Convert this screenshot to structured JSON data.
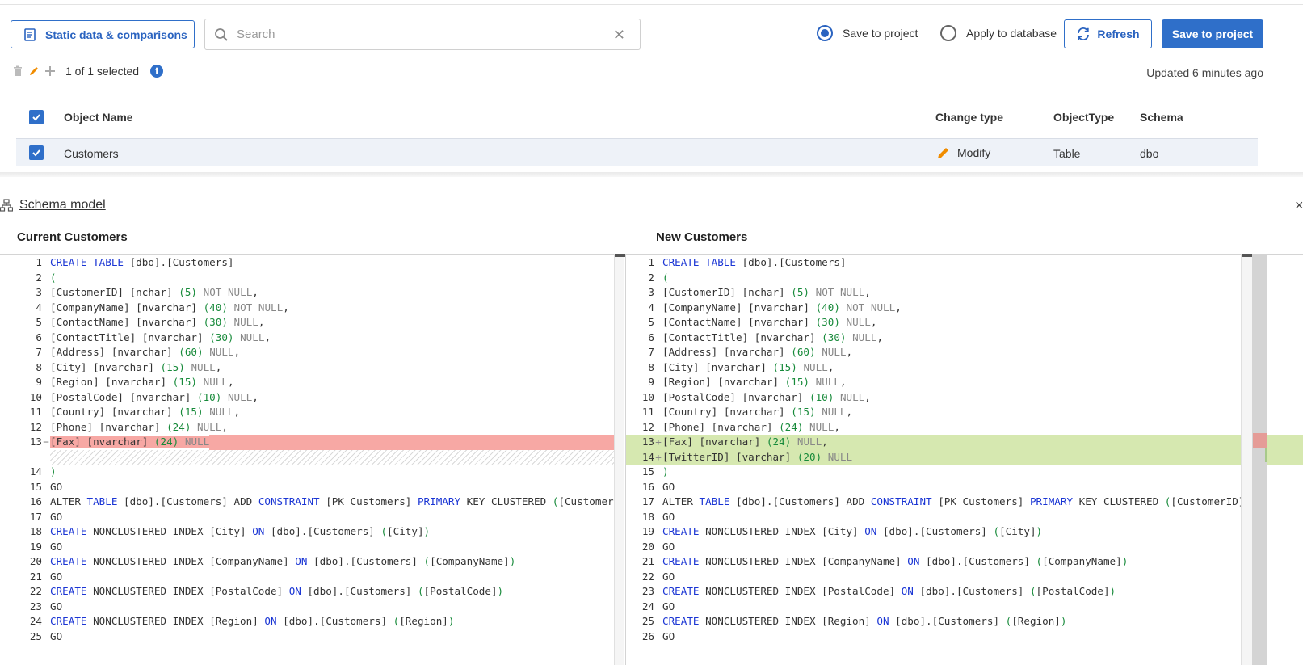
{
  "toolbar": {
    "static_label": "Static data & comparisons",
    "search_placeholder": "Search",
    "search_value": "",
    "clear_glyph": "✕",
    "radio_save": "Save to project",
    "radio_apply": "Apply to database",
    "refresh_label": "Refresh",
    "save_label": "Save to project",
    "selected_radio": "Save to project"
  },
  "selection": {
    "count_text": "1 of 1 selected",
    "info_glyph": "i",
    "updated_text": "Updated 6 minutes ago"
  },
  "table": {
    "headers": {
      "name": "Object Name",
      "change": "Change type",
      "otype": "ObjectType",
      "schema": "Schema"
    },
    "rows": [
      {
        "name": "Customers",
        "change": "Modify",
        "otype": "Table",
        "schema": "dbo",
        "checked": true
      }
    ]
  },
  "schema": {
    "link_label": "Schema model",
    "close_glyph": "×",
    "left_title": "Current Customers",
    "right_title": "New Customers"
  },
  "colors": {
    "accent": "#2f6fc9",
    "deleted": "#f7a8a4",
    "added": "#d6e8b0",
    "keyword": "#1a35d4",
    "number": "#178a3a"
  },
  "diff": {
    "left": [
      {
        "n": "1",
        "c": "CREATE TABLE [dbo].[Customers]"
      },
      {
        "n": "2",
        "c": "("
      },
      {
        "n": "3",
        "c": "[CustomerID] [nchar] (5) NOT NULL,"
      },
      {
        "n": "4",
        "c": "[CompanyName] [nvarchar] (40) NOT NULL,"
      },
      {
        "n": "5",
        "c": "[ContactName] [nvarchar] (30) NULL,"
      },
      {
        "n": "6",
        "c": "[ContactTitle] [nvarchar] (30) NULL,"
      },
      {
        "n": "7",
        "c": "[Address] [nvarchar] (60) NULL,"
      },
      {
        "n": "8",
        "c": "[City] [nvarchar] (15) NULL,"
      },
      {
        "n": "9",
        "c": "[Region] [nvarchar] (15) NULL,"
      },
      {
        "n": "10",
        "c": "[PostalCode] [nvarchar] (10) NULL,"
      },
      {
        "n": "11",
        "c": "[Country] [nvarchar] (15) NULL,"
      },
      {
        "n": "12",
        "c": "[Phone] [nvarchar] (24) NULL,"
      },
      {
        "n": "13",
        "c": "[Fax] [nvarchar] (24) NULL",
        "t": "del"
      },
      {
        "n": "",
        "c": "",
        "t": "gap"
      },
      {
        "n": "14",
        "c": ")"
      },
      {
        "n": "15",
        "c": "GO"
      },
      {
        "n": "16",
        "c": "ALTER TABLE [dbo].[Customers] ADD CONSTRAINT [PK_Customers] PRIMARY KEY CLUSTERED ([CustomerID])"
      },
      {
        "n": "17",
        "c": "GO"
      },
      {
        "n": "18",
        "c": "CREATE NONCLUSTERED INDEX [City] ON [dbo].[Customers] ([City])"
      },
      {
        "n": "19",
        "c": "GO"
      },
      {
        "n": "20",
        "c": "CREATE NONCLUSTERED INDEX [CompanyName] ON [dbo].[Customers] ([CompanyName])"
      },
      {
        "n": "21",
        "c": "GO"
      },
      {
        "n": "22",
        "c": "CREATE NONCLUSTERED INDEX [PostalCode] ON [dbo].[Customers] ([PostalCode])"
      },
      {
        "n": "23",
        "c": "GO"
      },
      {
        "n": "24",
        "c": "CREATE NONCLUSTERED INDEX [Region] ON [dbo].[Customers] ([Region])"
      },
      {
        "n": "25",
        "c": "GO"
      }
    ],
    "right": [
      {
        "n": "1",
        "c": "CREATE TABLE [dbo].[Customers]"
      },
      {
        "n": "2",
        "c": "("
      },
      {
        "n": "3",
        "c": "[CustomerID] [nchar] (5) NOT NULL,"
      },
      {
        "n": "4",
        "c": "[CompanyName] [nvarchar] (40) NOT NULL,"
      },
      {
        "n": "5",
        "c": "[ContactName] [nvarchar] (30) NULL,"
      },
      {
        "n": "6",
        "c": "[ContactTitle] [nvarchar] (30) NULL,"
      },
      {
        "n": "7",
        "c": "[Address] [nvarchar] (60) NULL,"
      },
      {
        "n": "8",
        "c": "[City] [nvarchar] (15) NULL,"
      },
      {
        "n": "9",
        "c": "[Region] [nvarchar] (15) NULL,"
      },
      {
        "n": "10",
        "c": "[PostalCode] [nvarchar] (10) NULL,"
      },
      {
        "n": "11",
        "c": "[Country] [nvarchar] (15) NULL,"
      },
      {
        "n": "12",
        "c": "[Phone] [nvarchar] (24) NULL,"
      },
      {
        "n": "13",
        "c": "[Fax] [nvarchar] (24) NULL,",
        "t": "add"
      },
      {
        "n": "14",
        "c": "[TwitterID] [varchar] (20) NULL",
        "t": "add"
      },
      {
        "n": "15",
        "c": ")"
      },
      {
        "n": "16",
        "c": "GO"
      },
      {
        "n": "17",
        "c": "ALTER TABLE [dbo].[Customers] ADD CONSTRAINT [PK_Customers] PRIMARY KEY CLUSTERED ([CustomerID])"
      },
      {
        "n": "18",
        "c": "GO"
      },
      {
        "n": "19",
        "c": "CREATE NONCLUSTERED INDEX [City] ON [dbo].[Customers] ([City])"
      },
      {
        "n": "20",
        "c": "GO"
      },
      {
        "n": "21",
        "c": "CREATE NONCLUSTERED INDEX [CompanyName] ON [dbo].[Customers] ([CompanyName])"
      },
      {
        "n": "22",
        "c": "GO"
      },
      {
        "n": "23",
        "c": "CREATE NONCLUSTERED INDEX [PostalCode] ON [dbo].[Customers] ([PostalCode])"
      },
      {
        "n": "24",
        "c": "GO"
      },
      {
        "n": "25",
        "c": "CREATE NONCLUSTERED INDEX [Region] ON [dbo].[Customers] ([Region])"
      },
      {
        "n": "26",
        "c": "GO"
      }
    ]
  }
}
